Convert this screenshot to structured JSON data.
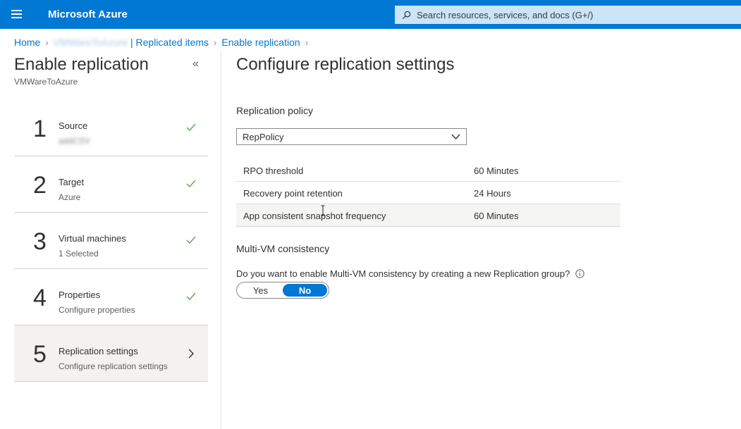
{
  "header": {
    "brand": "Microsoft Azure",
    "search_placeholder": "Search resources, services, and docs (G+/)"
  },
  "breadcrumb": {
    "home": "Home",
    "vault": "VMWareToAzure",
    "replicated_items": "| Replicated items",
    "enable_replication": "Enable replication"
  },
  "blade": {
    "title": "Enable replication",
    "subtitle": "VMWareToAzure"
  },
  "steps": [
    {
      "number": "1",
      "label": "Source",
      "sublabel": "addCSV",
      "status": "done"
    },
    {
      "number": "2",
      "label": "Target",
      "sublabel": "Azure",
      "status": "done"
    },
    {
      "number": "3",
      "label": "Virtual machines",
      "sublabel": "1 Selected",
      "status": "done"
    },
    {
      "number": "4",
      "label": "Properties",
      "sublabel": "Configure properties",
      "status": "done"
    },
    {
      "number": "5",
      "label": "Replication settings",
      "sublabel": "Configure replication settings",
      "status": "active"
    }
  ],
  "main": {
    "title": "Configure replication settings",
    "policy_label": "Replication policy",
    "policy_value": "RepPolicy",
    "policy_details": [
      {
        "key": "RPO threshold",
        "value": "60 Minutes"
      },
      {
        "key": "Recovery point retention",
        "value": "24 Hours"
      },
      {
        "key": "App consistent snapshot frequency",
        "value": "60 Minutes"
      }
    ],
    "mvm_label": "Multi-VM consistency",
    "mvm_question": "Do you want to enable Multi-VM consistency by creating a new Replication group?",
    "toggle": {
      "yes": "Yes",
      "no": "No",
      "selected": "No"
    }
  },
  "colors": {
    "accent": "#0078d4",
    "check": "#6aa84f"
  }
}
